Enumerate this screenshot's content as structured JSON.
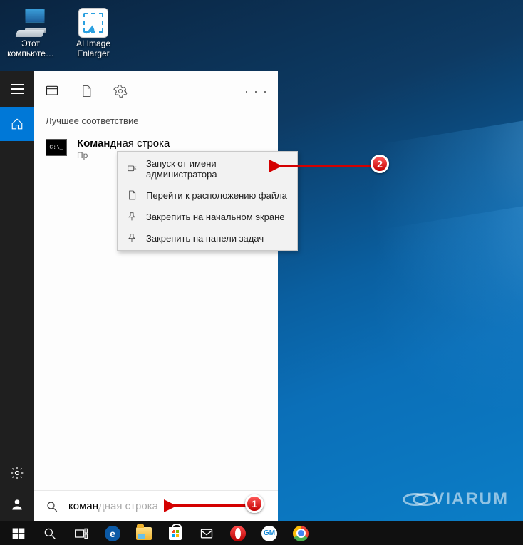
{
  "desktop": {
    "icons": [
      {
        "label": "Этот\nкомпьюте…"
      },
      {
        "label": "AI Image\nEnlarger"
      }
    ],
    "watermark": "VIARUM"
  },
  "search": {
    "left_rail": {
      "tooltip_menu": "Меню",
      "tooltip_home": "Главная",
      "tooltip_settings": "Параметры",
      "tooltip_user": "Профиль"
    },
    "section_label": "Лучшее соответствие",
    "result": {
      "title_match": "Коман",
      "title_rest": "дная строка",
      "subtitle": "Пр"
    },
    "context_menu": [
      "Запуск от имени администратора",
      "Перейти к расположению файла",
      "Закрепить на начальном экране",
      "Закрепить на панели задач"
    ],
    "input_typed": "коман",
    "input_ghost": "дная строка"
  },
  "annotations": {
    "step1": "1",
    "step2": "2"
  },
  "taskbar": {
    "items": [
      "start",
      "search",
      "taskview",
      "edge",
      "file-explorer",
      "store",
      "mail",
      "opera",
      "gm",
      "chrome"
    ]
  }
}
